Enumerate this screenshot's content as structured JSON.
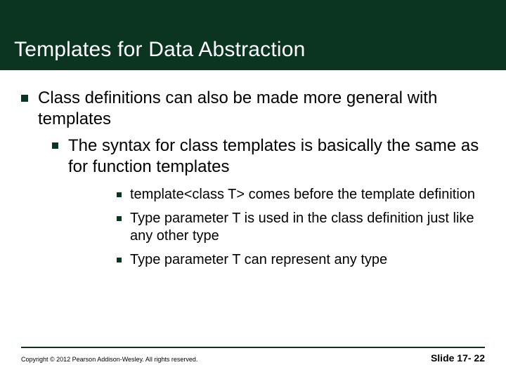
{
  "title": "Templates for Data Abstraction",
  "bullets": {
    "l1": "Class definitions can also be made more general with templates",
    "l2": "The syntax for class templates is basically the same as for function templates",
    "l3a": "template<class T> comes before the template definition",
    "l3b": "Type parameter T is used in the class definition just like any other type",
    "l3c": "Type parameter T can represent any type"
  },
  "footer": {
    "copyright": "Copyright © 2012 Pearson Addison-Wesley.  All rights reserved.",
    "slide_label": "Slide 17- 22"
  }
}
